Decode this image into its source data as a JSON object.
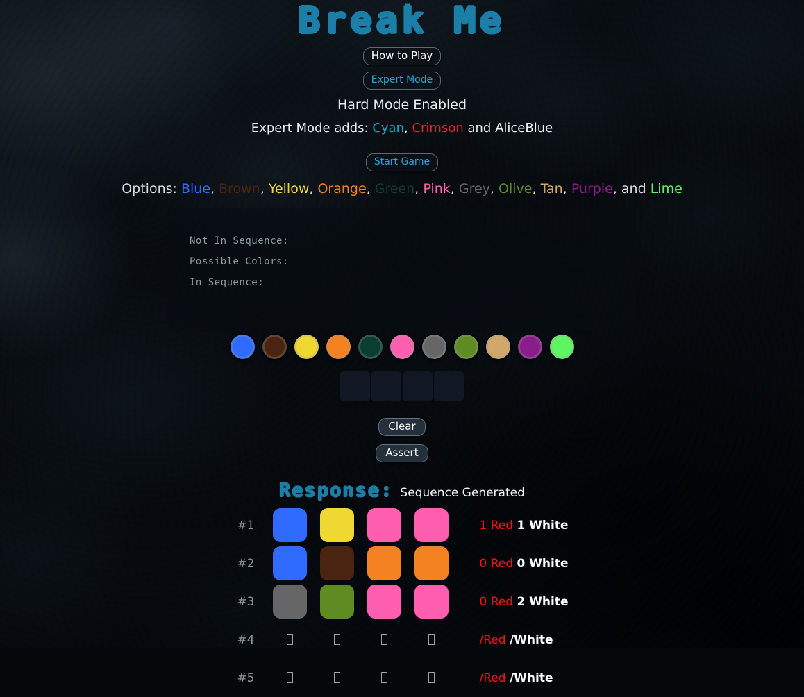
{
  "app": {
    "title": "Break Me"
  },
  "header": {
    "how_to_play_label": "How to Play",
    "expert_mode_label": "Expert Mode",
    "hard_mode_text": "Hard Mode Enabled",
    "expert_adds_prefix": "Expert Mode adds: ",
    "expert_adds_colors": [
      {
        "name": "Cyan",
        "hex": "#00b5c8"
      },
      {
        "name": "Crimson",
        "hex": "#e8202f"
      },
      {
        "name": "AliceBlue",
        "hex": "#eef4f8"
      }
    ],
    "expert_adds_sep1": ", ",
    "expert_adds_sep2": " and ",
    "start_game_label": "Start Game"
  },
  "options": {
    "prefix": "Options: ",
    "suffix": ", and ",
    "items": [
      {
        "name": "Blue",
        "hex": "#2f6bff"
      },
      {
        "name": "Brown",
        "hex": "#4a2410"
      },
      {
        "name": "Yellow",
        "hex": "#efd832"
      },
      {
        "name": "Orange",
        "hex": "#f58220"
      },
      {
        "name": "Green",
        "hex": "#0b3d30"
      },
      {
        "name": "Pink",
        "hex": "#ff5faf"
      },
      {
        "name": "Grey",
        "hex": "#666666"
      },
      {
        "name": "Olive",
        "hex": "#5e8c22"
      },
      {
        "name": "Tan",
        "hex": "#d2a86a"
      },
      {
        "name": "Purple",
        "hex": "#8b1c8b"
      },
      {
        "name": "Lime",
        "hex": "#5ff562"
      }
    ]
  },
  "hints": {
    "not_in_sequence_label": "Not In Sequence:",
    "possible_colors_label": "Possible Colors:",
    "in_sequence_label": "In Sequence:",
    "not_in_sequence_value": "",
    "possible_colors_value": "",
    "in_sequence_value": ""
  },
  "palette": [
    {
      "name": "blue",
      "hex": "#2f6bff"
    },
    {
      "name": "brown",
      "hex": "#4a2410"
    },
    {
      "name": "yellow",
      "hex": "#efd832"
    },
    {
      "name": "orange",
      "hex": "#f58220"
    },
    {
      "name": "green",
      "hex": "#0b3d30"
    },
    {
      "name": "pink",
      "hex": "#ff5faf"
    },
    {
      "name": "grey",
      "hex": "#666666"
    },
    {
      "name": "olive",
      "hex": "#5e8c22"
    },
    {
      "name": "tan",
      "hex": "#d2a86a"
    },
    {
      "name": "purple",
      "hex": "#8b1c8b"
    },
    {
      "name": "lime",
      "hex": "#5ff562"
    }
  ],
  "current_guess": {
    "slots": [
      "",
      "",
      "",
      ""
    ]
  },
  "controls": {
    "clear_label": "Clear",
    "assert_label": "Assert"
  },
  "response": {
    "label": "Response:",
    "status": "Sequence Generated"
  },
  "guesses": [
    {
      "index": "#1",
      "cells": [
        {
          "name": "blue",
          "hex": "#2f6bff"
        },
        {
          "name": "yellow",
          "hex": "#efd832"
        },
        {
          "name": "pink",
          "hex": "#ff5faf"
        },
        {
          "name": "pink",
          "hex": "#ff5faf"
        }
      ],
      "red": "1 Red",
      "white": "1 White"
    },
    {
      "index": "#2",
      "cells": [
        {
          "name": "blue",
          "hex": "#2f6bff"
        },
        {
          "name": "brown",
          "hex": "#4a2410"
        },
        {
          "name": "orange",
          "hex": "#f58220"
        },
        {
          "name": "orange",
          "hex": "#f58220"
        }
      ],
      "red": "0 Red",
      "white": "0 White"
    },
    {
      "index": "#3",
      "cells": [
        {
          "name": "grey",
          "hex": "#666666"
        },
        {
          "name": "olive",
          "hex": "#5e8c22"
        },
        {
          "name": "pink",
          "hex": "#ff5faf"
        },
        {
          "name": "pink",
          "hex": "#ff5faf"
        }
      ],
      "red": "0 Red",
      "white": "2 White"
    },
    {
      "index": "#4",
      "cells": [
        {
          "name": "empty",
          "hex": ""
        },
        {
          "name": "empty",
          "hex": ""
        },
        {
          "name": "empty",
          "hex": ""
        },
        {
          "name": "empty",
          "hex": ""
        }
      ],
      "red": "/Red",
      "white": "/White"
    },
    {
      "index": "#5",
      "cells": [
        {
          "name": "empty",
          "hex": ""
        },
        {
          "name": "empty",
          "hex": ""
        },
        {
          "name": "empty",
          "hex": ""
        },
        {
          "name": "empty",
          "hex": ""
        }
      ],
      "red": "/Red",
      "white": "/White"
    }
  ],
  "theme": {
    "accent": "#1b7fa8",
    "accent_bright": "#1fa8e0",
    "red": "#ff0f10",
    "white": "#ffffff",
    "background": "#080c10"
  }
}
